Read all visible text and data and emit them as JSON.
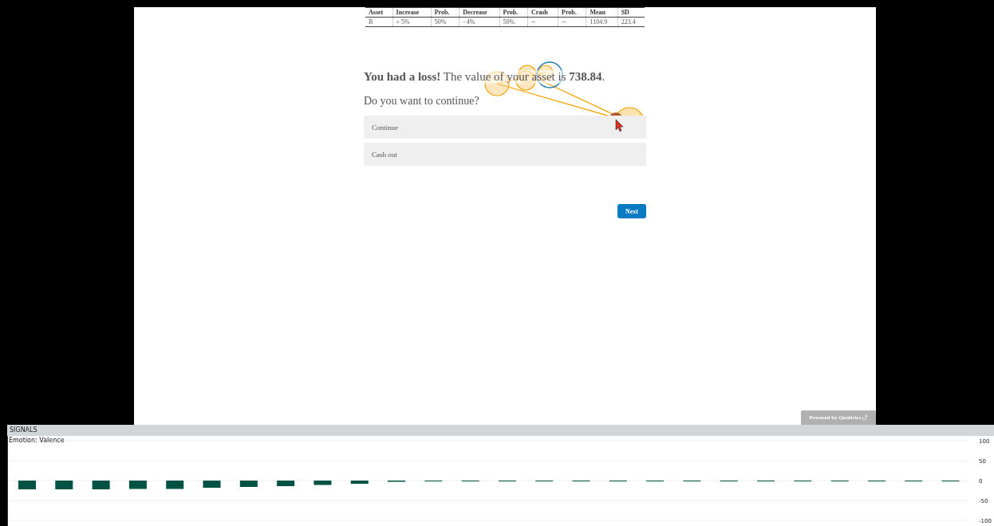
{
  "asset_table": {
    "columns": [
      "Asset",
      "Increase",
      "Prob.",
      "Decrease",
      "Prob.",
      "Crash",
      "Prob.",
      "Mean",
      "SD"
    ],
    "rows": [
      [
        "B",
        "+ 5%",
        "50%",
        "- 4%",
        "50%",
        "--",
        "--",
        "1104.9",
        "223.4"
      ]
    ]
  },
  "question": {
    "result": "**You had a loss!** The value of your asset is **738.84**.",
    "prompt": "Do you want to continue?",
    "options": [
      {
        "label": "Continue",
        "selected": false
      },
      {
        "label": "Cash out",
        "selected": false
      }
    ]
  },
  "next_button": "Next",
  "footer_badge": "Powered by Qualtrics",
  "signals": {
    "title": "SIGNALS",
    "chart_data": {
      "type": "bar",
      "grid": true,
      "ylim": [
        -100,
        100
      ],
      "yticks": [
        100,
        50,
        0,
        -50,
        -100
      ],
      "series": [
        {
          "name": "Emotion: Valence",
          "color": "#005244",
          "values": [
            -22,
            -22,
            -22,
            -21,
            -21,
            -18,
            -16,
            -14,
            -11,
            -8,
            -3,
            -1,
            -1,
            -1,
            -1,
            -1,
            -1,
            -1,
            -1,
            -1,
            -1,
            -1,
            -1,
            -1,
            -1,
            -1
          ]
        }
      ]
    }
  }
}
